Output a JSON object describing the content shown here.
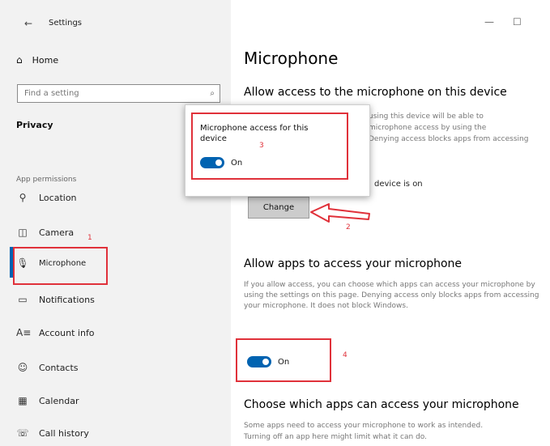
{
  "window": {
    "title": "Settings",
    "back_glyph": "←",
    "minimize_glyph": "—",
    "maximize_glyph": "☐"
  },
  "sidebar": {
    "home_label": "Home",
    "search_placeholder": "Find a setting",
    "section_title": "Privacy",
    "group_header": "App permissions",
    "items": [
      {
        "label": "Location",
        "icon": "location-icon"
      },
      {
        "label": "Camera",
        "icon": "camera-icon"
      },
      {
        "label": "Microphone",
        "icon": "microphone-icon"
      },
      {
        "label": "Notifications",
        "icon": "notifications-icon"
      },
      {
        "label": "Account info",
        "icon": "account-info-icon"
      },
      {
        "label": "Contacts",
        "icon": "contacts-icon"
      },
      {
        "label": "Calendar",
        "icon": "calendar-icon"
      },
      {
        "label": "Call history",
        "icon": "call-history-icon"
      }
    ]
  },
  "main": {
    "page_title": "Microphone",
    "allow_device_heading": "Allow access to the microphone on this device",
    "allow_device_desc_1": "using this device will be able to",
    "allow_device_desc_2": "microphone access by using the",
    "allow_device_desc_3": "Denying access blocks apps from accessing",
    "device_status": "device is on",
    "change_label": "Change",
    "allow_apps_heading": "Allow apps to access your microphone",
    "allow_apps_desc": "If you allow access, you can choose which apps can access your microphone by using the settings on this page. Denying access only blocks apps from accessing your microphone. It does not block Windows.",
    "toggle_label": "On",
    "choose_heading": "Choose which apps can access your microphone",
    "choose_desc_1": "Some apps need to access your microphone to work as intended.",
    "choose_desc_2": "Turning off an app here might limit what it can do."
  },
  "popup": {
    "title": "Microphone access for this device",
    "toggle_label": "On"
  },
  "annotations": {
    "step1": "1",
    "step2": "2",
    "step3": "3",
    "step4": "4",
    "color": "#e0313a"
  },
  "accent_color": "#0063b1"
}
